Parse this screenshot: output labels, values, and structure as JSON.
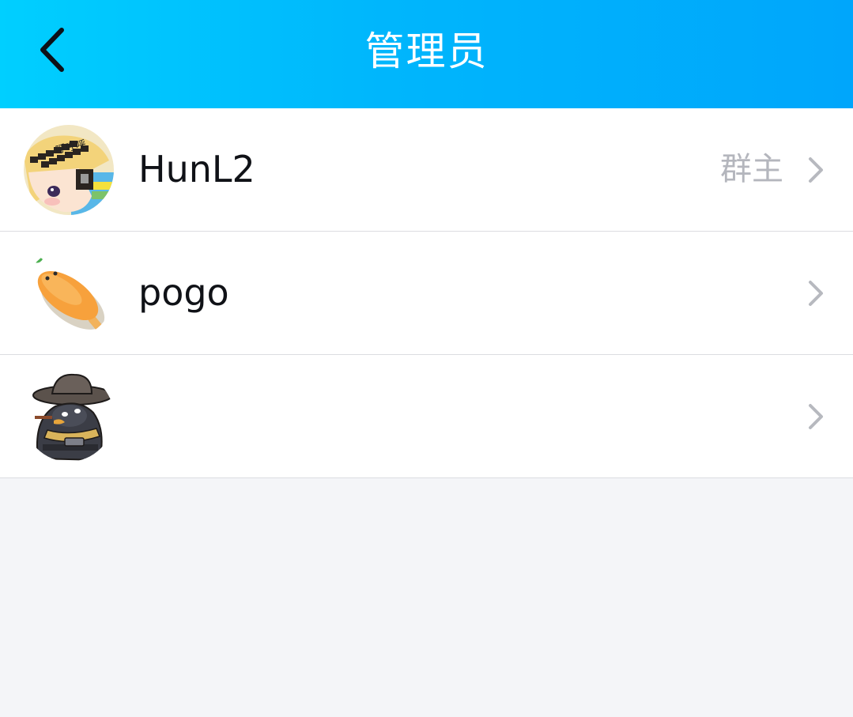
{
  "header": {
    "title": "管理员",
    "back_icon": "chevron-left-icon",
    "bg_color_start": "#00cfff",
    "bg_color_end": "#00a6fb"
  },
  "admins": [
    {
      "name": "HunL2",
      "role": "群主",
      "avatar_icon": "anime-girl-avatar",
      "avatar_text": "呼呼呼"
    },
    {
      "name": "pogo",
      "role": "",
      "avatar_icon": "orange-popsicle-avatar"
    },
    {
      "name": "",
      "role": "",
      "avatar_icon": "cowboy-penguin-avatar"
    }
  ],
  "row_chevron_icon": "chevron-right-icon"
}
